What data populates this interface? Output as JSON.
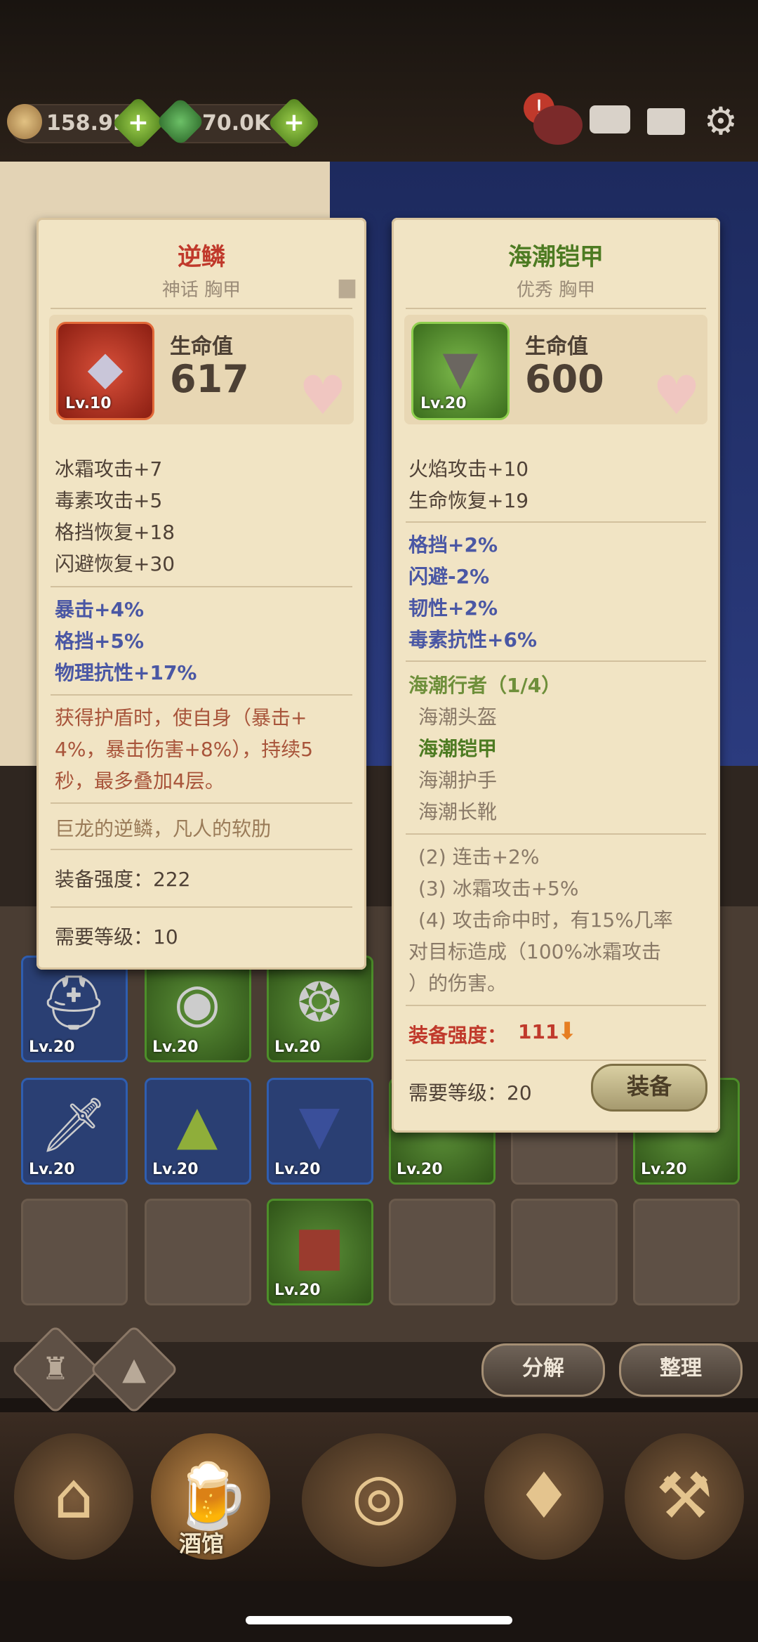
{
  "currencies": [
    {
      "name": "gold",
      "value": "158.9K",
      "color": "#c7a261"
    },
    {
      "name": "gem",
      "value": "70.0K",
      "color": "#4b9a45"
    }
  ],
  "top_icons": {
    "alert": "!",
    "chat": "chat-icon",
    "mail": "mail-icon",
    "settings": "gear-icon"
  },
  "left_card": {
    "name": "逆鳞",
    "subtitle": "神话 胸甲",
    "level_badge": "Lv.10",
    "hp_label": "生命值",
    "hp_value": "617",
    "basic_stats": [
      "冰霜攻击+7",
      "毒素攻击+5",
      "格挡恢复+18",
      "闪避恢复+30"
    ],
    "bonus_stats": [
      "暴击+4%",
      "格挡+5%",
      "物理抗性+17%"
    ],
    "special_lines": [
      "获得护盾时，使自身（暴击+",
      "4%，暴击伤害+8%），持续5",
      "秒，最多叠加4层。"
    ],
    "flavor": "巨龙的逆鳞，凡人的软肋",
    "power_label": "装备强度：222",
    "level_req": "需要等级：10",
    "name_color": "#c0392b"
  },
  "right_card": {
    "name": "海潮铠甲",
    "subtitle": "优秀 胸甲",
    "level_badge": "Lv.20",
    "hp_label": "生命值",
    "hp_value": "600",
    "basic_stats": [
      "火焰攻击+10",
      "生命恢复+19"
    ],
    "bonus_stats": [
      "格挡+2%",
      "闪避-2%",
      "韧性+2%",
      "毒素抗性+6%"
    ],
    "set_name": "海潮行者（1/4）",
    "set_items": [
      {
        "name": "海潮头盔",
        "owned": false
      },
      {
        "name": "海潮铠甲",
        "owned": true
      },
      {
        "name": "海潮护手",
        "owned": false
      },
      {
        "name": "海潮长靴",
        "owned": false
      }
    ],
    "set_bonuses": [
      "(2) 连击+2%",
      "(3) 冰霜攻击+5%",
      "(4) 攻击命中时，有15%几率",
      "对目标造成（100%冰霜攻击",
      "）的伤害。"
    ],
    "power_label": "装备强度：",
    "power_value": "111",
    "level_req": "需要等级：20",
    "equip_button": "装备",
    "name_color": "#4d7b22"
  },
  "inventory": {
    "slot_level": "Lv.20",
    "row1": [
      "helmet",
      "shield",
      "amulet"
    ],
    "row2": [
      "sword",
      "hood",
      "armor",
      "",
      "",
      ""
    ],
    "row3": [
      "",
      "",
      "book",
      "",
      "",
      ""
    ]
  },
  "buttons": {
    "decompose": "分解",
    "sort": "整理"
  },
  "nav": {
    "tavern_label": "酒馆"
  }
}
